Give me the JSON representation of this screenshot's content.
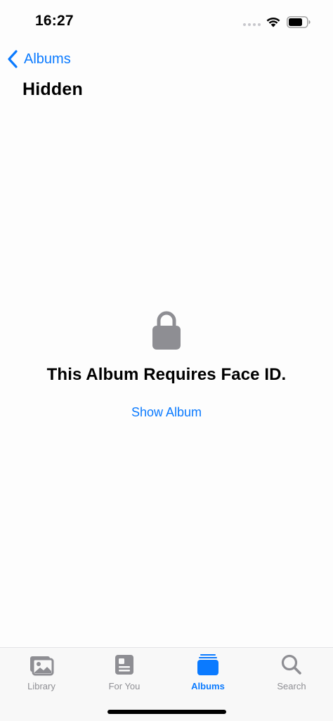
{
  "status_bar": {
    "time": "16:27"
  },
  "nav": {
    "back_label": "Albums",
    "title": "Hidden"
  },
  "locked": {
    "message": "This Album Requires Face ID.",
    "show_button": "Show Album",
    "icon": "lock-icon"
  },
  "tab_bar": {
    "active_index": 2,
    "tabs": [
      {
        "label": "Library",
        "icon": "library-icon"
      },
      {
        "label": "For You",
        "icon": "for-you-icon"
      },
      {
        "label": "Albums",
        "icon": "albums-icon"
      },
      {
        "label": "Search",
        "icon": "search-icon"
      }
    ]
  },
  "colors": {
    "accent": "#0a7aff",
    "inactive_gray": "#8e8e93",
    "lock_gray": "#8e8e93",
    "background": "#fdfdfd"
  }
}
